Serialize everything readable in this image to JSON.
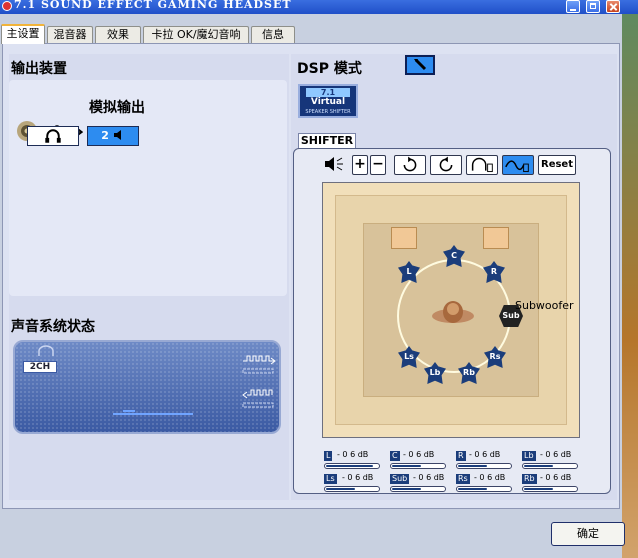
{
  "window": {
    "title": "7.1 SOUND EFFECT GAMING HEADSET"
  },
  "tabs": [
    {
      "label": "主设置",
      "active": true
    },
    {
      "label": "混音器",
      "active": false
    },
    {
      "label": "效果",
      "active": false
    },
    {
      "label": "卡拉 OK/魔幻音响",
      "active": false
    },
    {
      "label": "信息",
      "active": false
    }
  ],
  "output": {
    "heading": "输出装置",
    "mode_label": "模拟输出",
    "speaker_button_label": "2"
  },
  "status": {
    "heading": "声音系统状态",
    "channel_badge": "2CH"
  },
  "dsp": {
    "heading": "DSP 模式",
    "logo_line1": "7.1",
    "logo_line2": "Virtual",
    "logo_line3": "SPEAKER SHIFTER"
  },
  "shifter": {
    "tab_label": "SHIFTER",
    "reset_label": "Reset",
    "subwoofer_label": "Subwoofer",
    "speakers": [
      "C",
      "L",
      "R",
      "Sub",
      "Ls",
      "Lb",
      "Rb",
      "Rs"
    ]
  },
  "levels": [
    {
      "tag": "L",
      "value": "- 0 6 dB",
      "fill": 0.9
    },
    {
      "tag": "C",
      "value": "- 0 6 dB",
      "fill": 0.55
    },
    {
      "tag": "R",
      "value": "- 0 6 dB",
      "fill": 0.55
    },
    {
      "tag": "Lb",
      "value": "- 0 6 dB",
      "fill": 0.55
    },
    {
      "tag": "Ls",
      "value": "- 0 6 dB",
      "fill": 0.55
    },
    {
      "tag": "Sub",
      "value": "- 0 6 dB",
      "fill": 0.55
    },
    {
      "tag": "Rs",
      "value": "- 0 6 dB",
      "fill": 0.55
    },
    {
      "tag": "Rb",
      "value": "- 0 6 dB",
      "fill": 0.55
    }
  ],
  "footer": {
    "ok_label": "确定"
  }
}
